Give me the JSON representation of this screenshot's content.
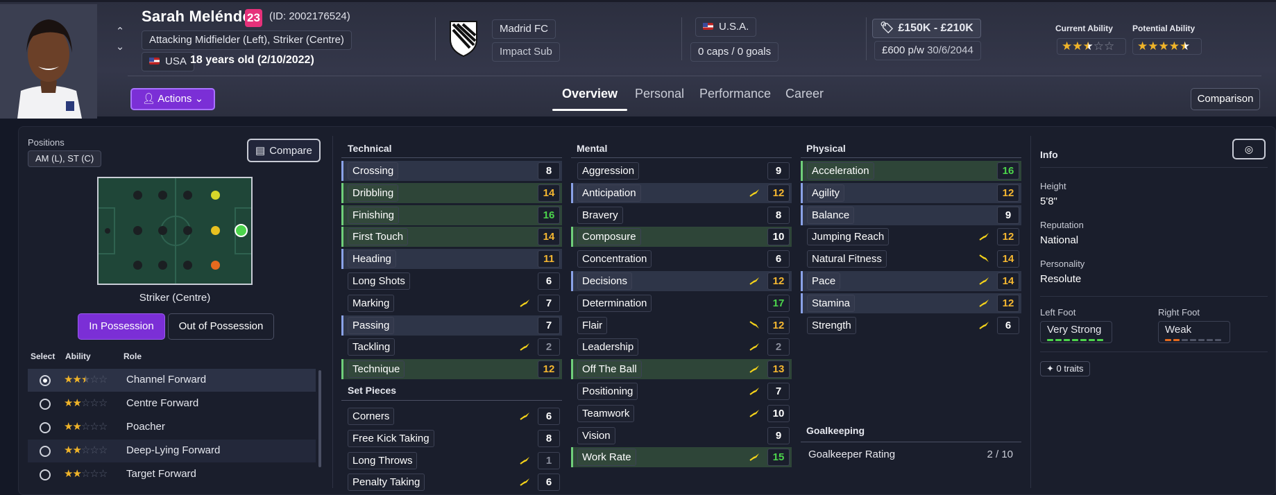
{
  "player": {
    "name": "Sarah Meléndez",
    "number": "23",
    "id": "(ID: 2002176524)",
    "position": "Attacking Midfielder (Left), Striker (Centre)",
    "nationality": "USA",
    "age": "18 years old (2/10/2022)"
  },
  "club": {
    "name": "Madrid FC",
    "status": "Impact Sub"
  },
  "international": {
    "country": "U.S.A.",
    "caps": "0 caps / 0 goals"
  },
  "contract": {
    "value": "£150K - £210K",
    "wage": "£600 p/w",
    "expiry": "30/6/2044"
  },
  "ability": {
    "current_label": "Current Ability",
    "current_stars": 2.5,
    "potential_label": "Potential Ability",
    "potential_stars": 4.5
  },
  "actions_label": "Actions",
  "tabs": [
    "Overview",
    "Personal",
    "Performance",
    "Career"
  ],
  "comparison_label": "Comparison",
  "positions": {
    "label": "Positions",
    "value": "AM (L), ST (C)",
    "compare_label": "Compare",
    "selected_position": "Striker (Centre)"
  },
  "possession": {
    "in": "In Possession",
    "out": "Out of Possession"
  },
  "roles": {
    "headers": {
      "select": "Select",
      "ability": "Ability",
      "role": "Role"
    },
    "rows": [
      {
        "name": "Channel Forward",
        "stars": 2.5,
        "selected": true
      },
      {
        "name": "Centre Forward",
        "stars": 2,
        "selected": false
      },
      {
        "name": "Poacher",
        "stars": 2,
        "selected": false
      },
      {
        "name": "Deep-Lying Forward",
        "stars": 2,
        "selected": false
      },
      {
        "name": "Target Forward",
        "stars": 2,
        "selected": false
      }
    ]
  },
  "technical": {
    "title": "Technical",
    "attrs": [
      {
        "name": "Crossing",
        "value": "8",
        "hl": "blue",
        "trend": ""
      },
      {
        "name": "Dribbling",
        "value": "14",
        "hl": "green",
        "trend": ""
      },
      {
        "name": "Finishing",
        "value": "16",
        "hl": "green",
        "trend": ""
      },
      {
        "name": "First Touch",
        "value": "14",
        "hl": "green",
        "trend": ""
      },
      {
        "name": "Heading",
        "value": "11",
        "hl": "blue",
        "trend": ""
      },
      {
        "name": "Long Shots",
        "value": "6",
        "hl": "",
        "trend": ""
      },
      {
        "name": "Marking",
        "value": "7",
        "hl": "",
        "trend": "up"
      },
      {
        "name": "Passing",
        "value": "7",
        "hl": "blue",
        "trend": ""
      },
      {
        "name": "Tackling",
        "value": "2",
        "hl": "",
        "trend": "up"
      },
      {
        "name": "Technique",
        "value": "12",
        "hl": "green",
        "trend": ""
      }
    ]
  },
  "set_pieces": {
    "title": "Set Pieces",
    "attrs": [
      {
        "name": "Corners",
        "value": "6",
        "hl": "",
        "trend": "up"
      },
      {
        "name": "Free Kick Taking",
        "value": "8",
        "hl": "",
        "trend": ""
      },
      {
        "name": "Long Throws",
        "value": "1",
        "hl": "",
        "trend": "up"
      },
      {
        "name": "Penalty Taking",
        "value": "6",
        "hl": "",
        "trend": "up"
      }
    ]
  },
  "mental": {
    "title": "Mental",
    "attrs": [
      {
        "name": "Aggression",
        "value": "9",
        "hl": "",
        "trend": ""
      },
      {
        "name": "Anticipation",
        "value": "12",
        "hl": "blue",
        "trend": "up"
      },
      {
        "name": "Bravery",
        "value": "8",
        "hl": "",
        "trend": ""
      },
      {
        "name": "Composure",
        "value": "10",
        "hl": "green",
        "trend": ""
      },
      {
        "name": "Concentration",
        "value": "6",
        "hl": "",
        "trend": ""
      },
      {
        "name": "Decisions",
        "value": "12",
        "hl": "blue",
        "trend": "up"
      },
      {
        "name": "Determination",
        "value": "17",
        "hl": "",
        "trend": ""
      },
      {
        "name": "Flair",
        "value": "12",
        "hl": "",
        "trend": "down"
      },
      {
        "name": "Leadership",
        "value": "2",
        "hl": "",
        "trend": "up"
      },
      {
        "name": "Off The Ball",
        "value": "13",
        "hl": "green",
        "trend": "up"
      },
      {
        "name": "Positioning",
        "value": "7",
        "hl": "",
        "trend": "up"
      },
      {
        "name": "Teamwork",
        "value": "10",
        "hl": "",
        "trend": "up"
      },
      {
        "name": "Vision",
        "value": "9",
        "hl": "",
        "trend": ""
      },
      {
        "name": "Work Rate",
        "value": "15",
        "hl": "green",
        "trend": "up"
      }
    ]
  },
  "physical": {
    "title": "Physical",
    "attrs": [
      {
        "name": "Acceleration",
        "value": "16",
        "hl": "green",
        "trend": ""
      },
      {
        "name": "Agility",
        "value": "12",
        "hl": "blue",
        "trend": ""
      },
      {
        "name": "Balance",
        "value": "9",
        "hl": "blue",
        "trend": ""
      },
      {
        "name": "Jumping Reach",
        "value": "12",
        "hl": "",
        "trend": "up"
      },
      {
        "name": "Natural Fitness",
        "value": "14",
        "hl": "",
        "trend": "down"
      },
      {
        "name": "Pace",
        "value": "14",
        "hl": "blue",
        "trend": "up"
      },
      {
        "name": "Stamina",
        "value": "12",
        "hl": "blue",
        "trend": "up"
      },
      {
        "name": "Strength",
        "value": "6",
        "hl": "",
        "trend": "up"
      }
    ]
  },
  "goalkeeping": {
    "title": "Goalkeeping",
    "label": "Goalkeeper Rating",
    "value": "2 / 10"
  },
  "info": {
    "title": "Info",
    "height_label": "Height",
    "height": "5'8\"",
    "reputation_label": "Reputation",
    "reputation": "National",
    "personality_label": "Personality",
    "personality": "Resolute",
    "left_foot_label": "Left Foot",
    "left_foot": "Very Strong",
    "right_foot_label": "Right Foot",
    "right_foot": "Weak",
    "traits": "0 traits"
  },
  "colors": {
    "accent": "#7b2fd6",
    "green_value": "#4cd44c",
    "amber_value": "#f5b731",
    "white_value": "#ffffff",
    "dim_value": "#8a8e9c",
    "trend_up": "#f5d31a"
  }
}
